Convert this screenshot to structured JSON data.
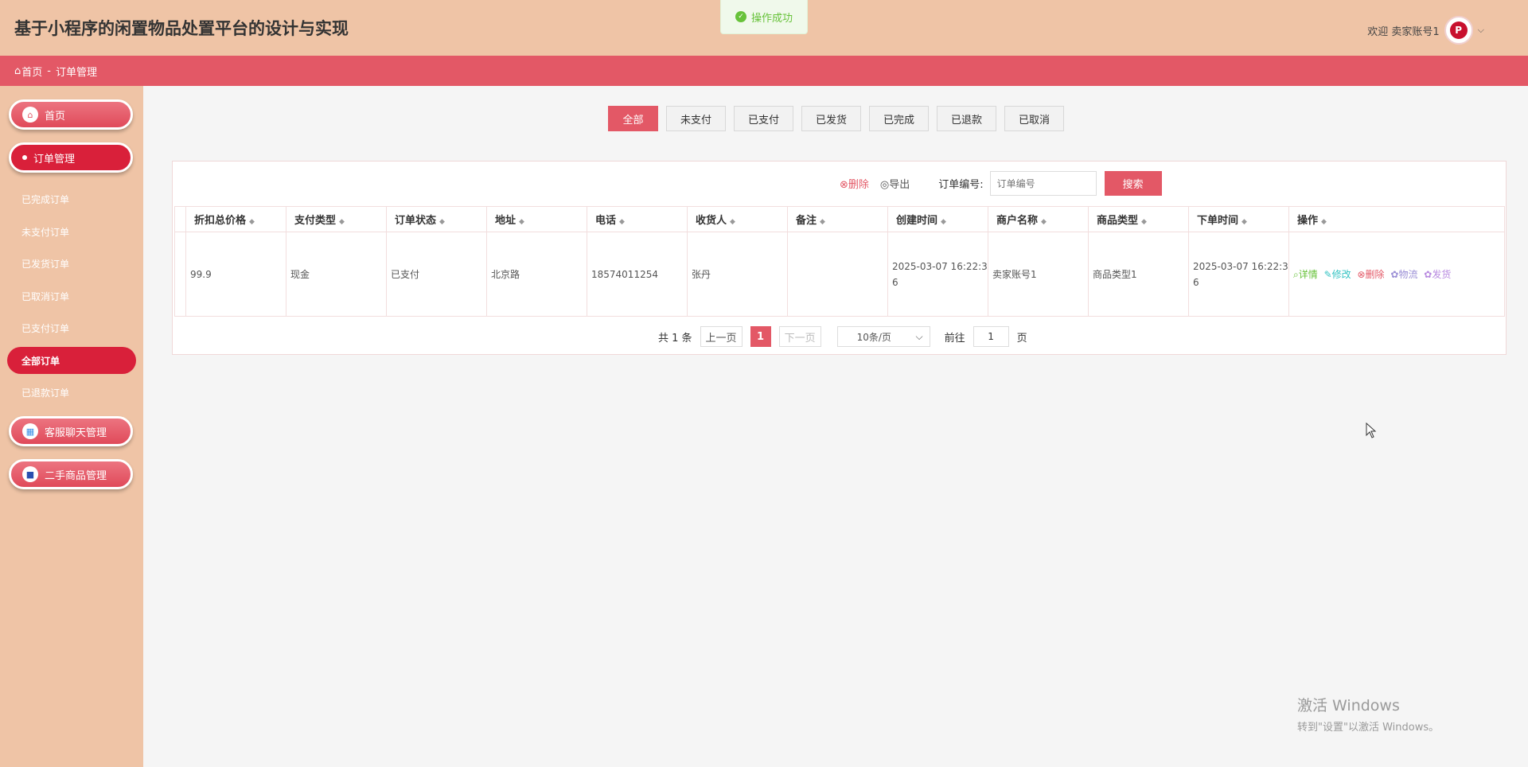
{
  "header": {
    "title": "基于小程序的闲置物品处置平台的设计与实现",
    "welcome": "欢迎 卖家账号1",
    "avatar_letter": "P"
  },
  "toast": {
    "message": "操作成功"
  },
  "breadcrumb": {
    "home": "首页",
    "separator": "-",
    "current": "订单管理"
  },
  "sidebar": {
    "home": "首页",
    "orders": "订单管理",
    "sub_items": [
      "已完成订单",
      "未支付订单",
      "已发货订单",
      "已取消订单",
      "已支付订单",
      "全部订单",
      "已退款订单"
    ],
    "chat": "客服聊天管理",
    "goods": "二手商品管理"
  },
  "tabs": [
    "全部",
    "未支付",
    "已支付",
    "已发货",
    "已完成",
    "已退款",
    "已取消"
  ],
  "toolbar": {
    "delete": "删除",
    "export": "导出",
    "order_no_label": "订单编号:",
    "order_no_placeholder": "订单编号",
    "search": "搜索"
  },
  "table": {
    "columns": [
      "折扣总价格",
      "支付类型",
      "订单状态",
      "地址",
      "电话",
      "收货人",
      "备注",
      "创建时间",
      "商户名称",
      "商品类型",
      "下单时间",
      "操作"
    ],
    "rows": [
      {
        "price": "99.9",
        "pay_type": "现金",
        "status": "已支付",
        "address": "北京路",
        "phone": "18574011254",
        "receiver": "张丹",
        "remark": "",
        "created": "2025-03-07 16:22:36",
        "merchant": "卖家账号1",
        "goods_type": "商品类型1",
        "order_time": "2025-03-07 16:22:36"
      }
    ],
    "actions": [
      "详情",
      "修改",
      "删除",
      "物流",
      "发货"
    ]
  },
  "pager": {
    "total": "共 1 条",
    "prev": "上一页",
    "page": "1",
    "next": "下一页",
    "size": "10条/页",
    "goto_label": "前往",
    "goto_value": "1",
    "page_unit": "页"
  },
  "watermark": {
    "line1": "激活 Windows",
    "line2": "转到\"设置\"以激活 Windows。"
  },
  "colors": {
    "accent": "#e35866",
    "header_bg": "#efc4a6",
    "active": "#d9203a"
  }
}
